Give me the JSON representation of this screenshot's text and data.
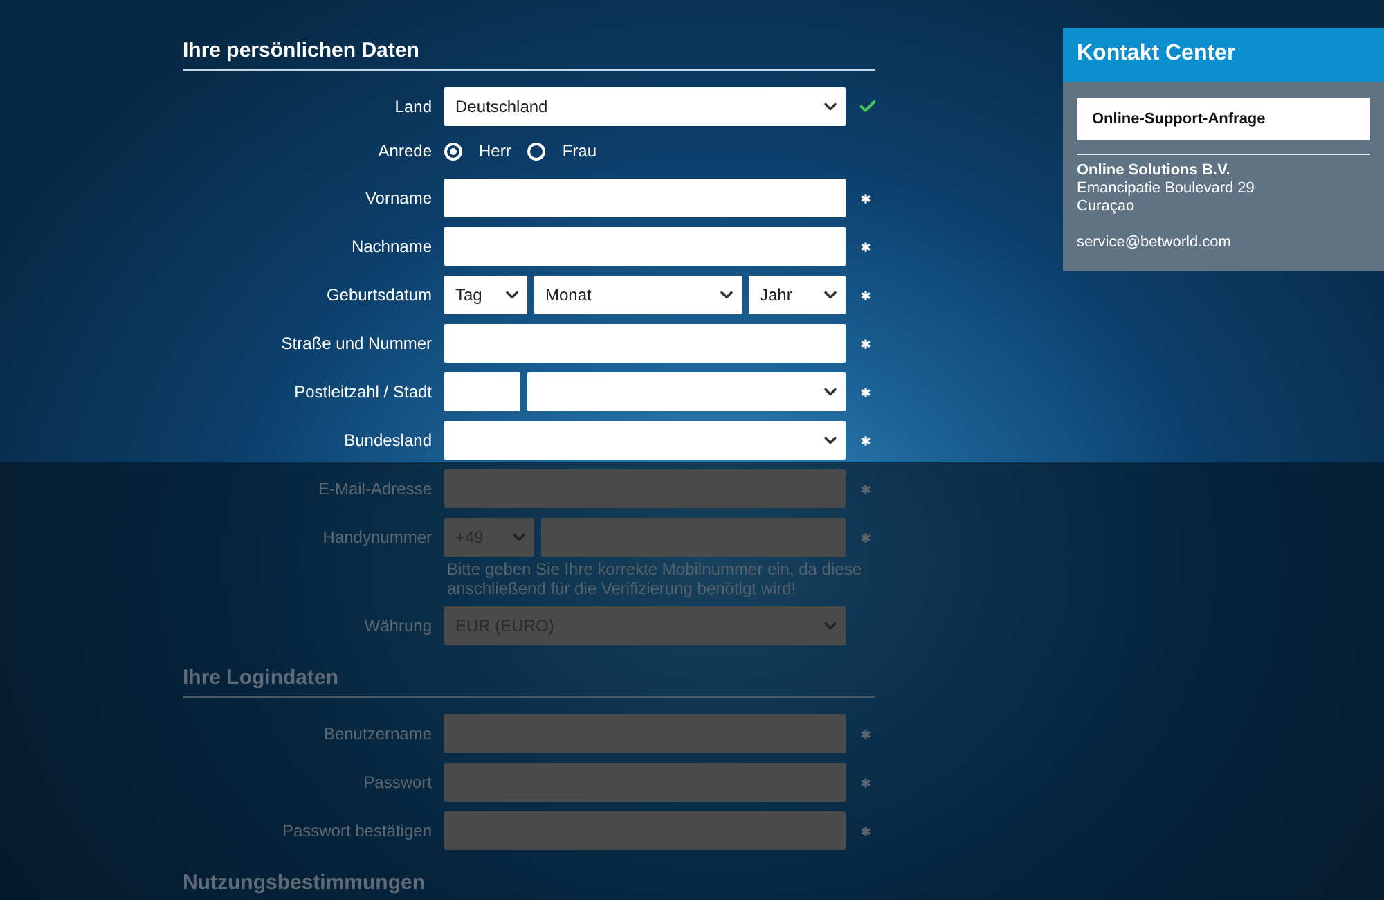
{
  "sections": [
    {
      "title": "Ihre persönlichen Daten",
      "dimmed": false,
      "rows": [
        {
          "kind": "select",
          "label": "Land",
          "value": "Deutschland",
          "valid": true,
          "dimmed": false
        },
        {
          "kind": "radio",
          "label": "Anrede",
          "dimmed": false,
          "options": [
            {
              "label": "Herr",
              "selected": true
            },
            {
              "label": "Frau",
              "selected": false
            }
          ]
        },
        {
          "kind": "text",
          "label": "Vorname",
          "required": true,
          "dimmed": false
        },
        {
          "kind": "text",
          "label": "Nachname",
          "required": true,
          "dimmed": false
        },
        {
          "kind": "date",
          "label": "Geburtsdatum",
          "parts": [
            "Tag",
            "Monat",
            "Jahr"
          ],
          "required": true,
          "dimmed": false
        },
        {
          "kind": "text",
          "label": "Straße und Nummer",
          "required": true,
          "dimmed": false
        },
        {
          "kind": "postal",
          "label": "Postleitzahl / Stadt",
          "required": true,
          "dimmed": false
        },
        {
          "kind": "select",
          "label": "Bundesland",
          "required": true,
          "dimmed": false
        },
        {
          "kind": "text",
          "label": "E-Mail-Adresse",
          "required": true,
          "dimmed": true
        },
        {
          "kind": "phone",
          "label": "Handynummer",
          "prefix": "+49",
          "required": true,
          "dimmed": true,
          "note": "Bitte geben Sie Ihre korrekte Mobilnummer ein, da diese anschließend für die Verifizierung benötigt wird!"
        },
        {
          "kind": "select",
          "label": "Währung",
          "value": "EUR (EURO)",
          "required": false,
          "dimmed": true
        }
      ]
    },
    {
      "title": "Ihre Logindaten",
      "dimmed": true,
      "rows": [
        {
          "kind": "text",
          "label": "Benutzername",
          "required": true,
          "dimmed": true
        },
        {
          "kind": "text",
          "label": "Passwort",
          "required": true,
          "dimmed": true
        },
        {
          "kind": "text",
          "label": "Passwort bestätigen",
          "required": true,
          "dimmed": true
        }
      ]
    },
    {
      "title": "Nutzungsbestimmungen",
      "dimmed": true
    }
  ],
  "contact": {
    "title": "Kontakt Center",
    "button": "Online-Support-Anfrage",
    "company": "Online Solutions B.V.",
    "address": [
      "Emancipatie Boulevard 29",
      "Curaçao"
    ],
    "email": "service@betworld.com"
  }
}
